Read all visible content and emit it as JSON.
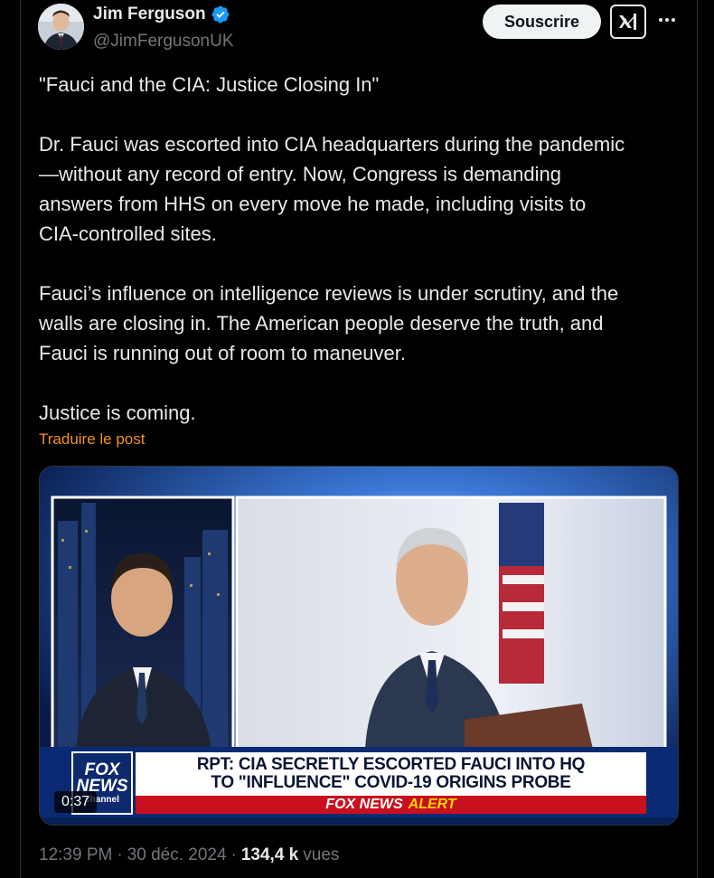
{
  "author": {
    "display_name": "Jim Ferguson",
    "handle": "@JimFergusonUK",
    "verified_icon": "verified-badge-icon",
    "avatar_icon": "avatar"
  },
  "actions": {
    "subscribe_label": "Souscrire",
    "grok_icon": "grok-icon",
    "more_icon": "more-options-icon"
  },
  "post": {
    "paragraphs": [
      "\"Fauci and the CIA: Justice Closing In\"",
      "Dr. Fauci was escorted into CIA headquarters during the pandemic\n—without any record of entry. Now, Congress is demanding\nanswers from HHS on every move he made, including visits to\nCIA-controlled sites.",
      "Fauci’s influence on intelligence reviews is under scrutiny, and the\nwalls are closing in. The American people deserve the truth, and\nFauci is running out of room to maneuver.",
      "Justice is coming."
    ],
    "translate_label": "Traduire le post"
  },
  "video": {
    "logo_top": "FOX",
    "logo_mid": "NEWS",
    "logo_bottom": "channel",
    "headline_line1": "RPT: CIA SECRETLY ESCORTED FAUCI INTO HQ",
    "headline_line2": "TO \"INFLUENCE\" COVID-19 ORIGINS PROBE",
    "alert_brand": "FOX NEWS",
    "alert_word": "ALERT",
    "duration": "0:37"
  },
  "meta": {
    "time": "12:39 PM",
    "separator": "·",
    "date": "30 déc. 2024",
    "views_count": "134,4 k",
    "views_label": "vues"
  },
  "colors": {
    "background": "#000000",
    "text": "#e7e9ea",
    "secondary": "#71767b",
    "translate_link": "#f4921b",
    "verified_blue": "#1d9bf0",
    "fox_red": "#c8101e",
    "fox_blue": "#0e2a6e"
  }
}
